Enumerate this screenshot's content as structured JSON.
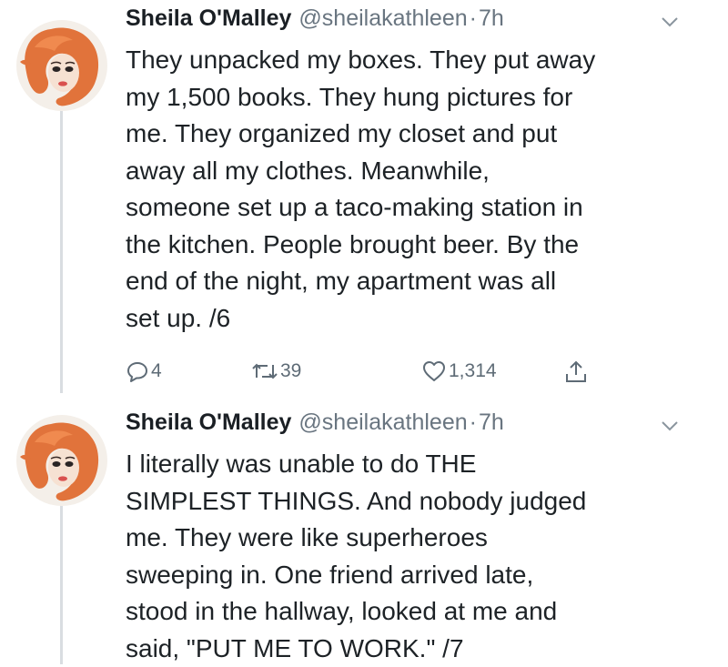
{
  "tweets": [
    {
      "name": "Sheila O'Malley",
      "handle": "@sheilakathleen",
      "separator": "·",
      "time": "7h",
      "lines": [
        "They unpacked my boxes. They put away",
        "my 1,500 books. They hung pictures for",
        "me. They organized my closet and put",
        "away all my clothes. Meanwhile,",
        "someone set up a taco-making station in",
        "the kitchen. People brought beer. By the",
        "end of the night, my apartment was all",
        "set up. /6"
      ],
      "replies": "4",
      "retweets": "39",
      "likes": "1,314"
    },
    {
      "name": "Sheila O'Malley",
      "handle": "@sheilakathleen",
      "separator": "·",
      "time": "7h",
      "lines": [
        "I literally was unable to do THE",
        "SIMPLEST THINGS. And nobody judged",
        "me. They were like superheroes",
        "sweeping in. One friend arrived late,",
        "stood in the hallway, looked at me and",
        "said, \"PUT ME TO WORK.\" /7"
      ]
    }
  ],
  "icons": {
    "reply": "reply-icon",
    "retweet": "retweet-icon",
    "like": "heart-icon",
    "share": "share-icon",
    "menu": "chevron-down-icon"
  },
  "colors": {
    "text": "#1d2226",
    "muted": "#697580",
    "thread_line": "#d9dde1",
    "avatar_background": "#f4efe9",
    "avatar_hair": "#e1733b"
  }
}
